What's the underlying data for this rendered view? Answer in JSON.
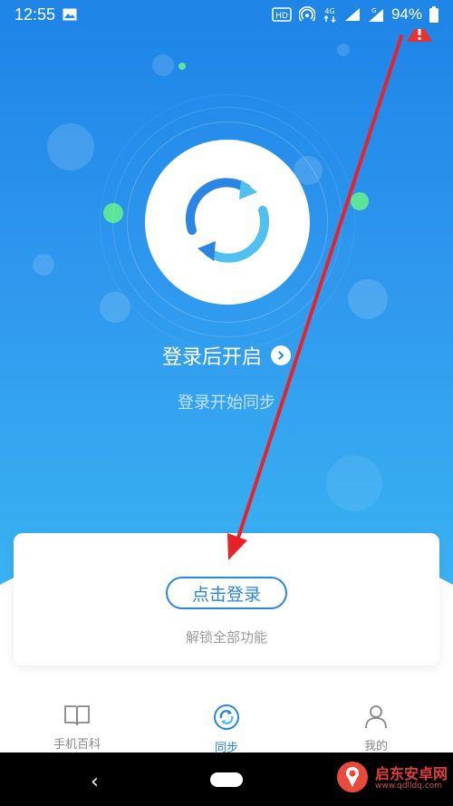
{
  "status_bar": {
    "time": "12:55",
    "battery_percent": "94%",
    "icons": [
      "image-icon",
      "hd-icon",
      "hotspot-icon",
      "4g-signal-icon",
      "signal-icon",
      "g-signal-icon",
      "battery-icon"
    ]
  },
  "hero": {
    "title": "登录后开启",
    "subtitle": "登录开始同步"
  },
  "card": {
    "login_button": "点击登录",
    "subtitle": "解锁全部功能"
  },
  "nav": {
    "items": [
      {
        "label": "手机百科",
        "icon": "book-icon"
      },
      {
        "label": "同步",
        "icon": "sync-icon"
      },
      {
        "label": "我的",
        "icon": "person-icon"
      }
    ],
    "active_index": 1
  },
  "system_nav": {
    "back_symbol": "‹"
  },
  "watermark": {
    "title": "启东安卓网",
    "url": "www.qdlldq.com"
  },
  "colors": {
    "primary": "#2a85e0",
    "hero_top": "#1f86e8",
    "hero_bottom": "#3ab3f2",
    "accent_green": "#5ee39a",
    "annotation_red": "#e8222a"
  }
}
